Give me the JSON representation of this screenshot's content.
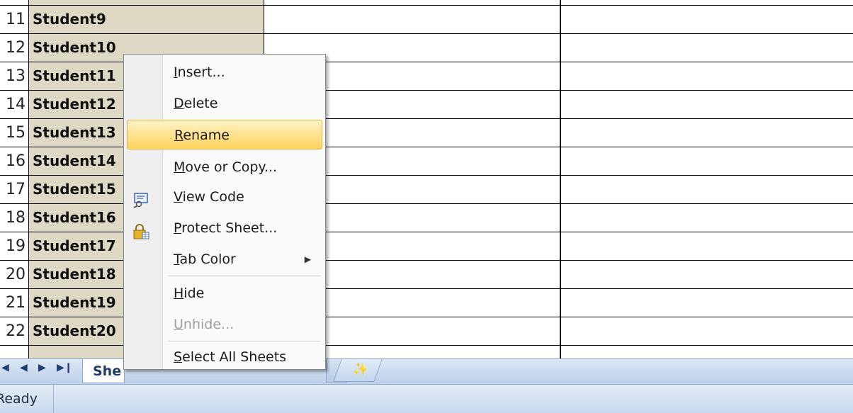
{
  "rows": [
    {
      "num": "11",
      "name": "Student9"
    },
    {
      "num": "12",
      "name": "Student10"
    },
    {
      "num": "13",
      "name": "Student11"
    },
    {
      "num": "14",
      "name": "Student12"
    },
    {
      "num": "15",
      "name": "Student13"
    },
    {
      "num": "16",
      "name": "Student14"
    },
    {
      "num": "17",
      "name": "Student15"
    },
    {
      "num": "18",
      "name": "Student16"
    },
    {
      "num": "19",
      "name": "Student17"
    },
    {
      "num": "20",
      "name": "Student18"
    },
    {
      "num": "21",
      "name": "Student19"
    },
    {
      "num": "22",
      "name": "Student20"
    }
  ],
  "context_menu": {
    "items": [
      {
        "label": "Insert...",
        "mnemonic": "I"
      },
      {
        "label": "Delete",
        "mnemonic": "D"
      },
      {
        "label": "Rename",
        "mnemonic": "R",
        "highlighted": true
      },
      {
        "label": "Move or Copy...",
        "mnemonic": "M"
      },
      {
        "label": "View Code",
        "mnemonic": "V",
        "icon": "view-code-icon"
      },
      {
        "label": "Protect Sheet...",
        "mnemonic": "P",
        "icon": "protect-sheet-lock-icon"
      },
      {
        "label": "Tab Color",
        "mnemonic": "T",
        "submenu": true
      },
      {
        "label": "Hide",
        "mnemonic": "H"
      },
      {
        "label": "Unhide...",
        "mnemonic": "U",
        "disabled": true
      },
      {
        "label": "Select All Sheets",
        "mnemonic": "S"
      }
    ]
  },
  "sheet_tabs": {
    "active_visible_text": "She",
    "icons": [
      "first-sheet-icon",
      "prev-sheet-icon",
      "next-sheet-icon",
      "last-sheet-icon",
      "insert-worksheet-icon"
    ]
  },
  "status_bar": {
    "status": "Ready"
  },
  "colors": {
    "name_cell_bg": "#ddd9c4",
    "menu_highlight": "#ffd35c",
    "tab_bar": "#bccfe9"
  }
}
